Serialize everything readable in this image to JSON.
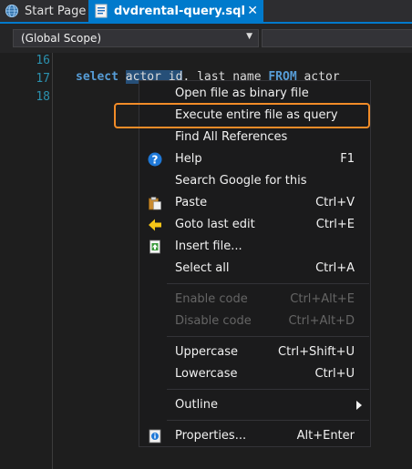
{
  "tabs": [
    {
      "label": "Start Page",
      "icon": "globe-icon"
    },
    {
      "label": "dvdrental-query.sql",
      "icon": "sql-file-icon",
      "close": "✕"
    }
  ],
  "scope": {
    "value": "(Global Scope)"
  },
  "editor": {
    "line_numbers": [
      "16",
      "17",
      "18"
    ],
    "code": {
      "kw1": "select",
      "sel": "actor_id",
      "rest1": ", last_name ",
      "kw2": "FROM",
      "rest2": " actor"
    }
  },
  "menu": {
    "items": [
      {
        "label": "Open file as binary file",
        "shortcut": ""
      },
      {
        "label": "Execute entire file as query",
        "shortcut": ""
      },
      {
        "label": "Find All References",
        "shortcut": ""
      },
      {
        "label": "Help",
        "shortcut": "F1",
        "icon": "help-icon"
      },
      {
        "label": "Search Google for this",
        "shortcut": ""
      },
      {
        "label": "Paste",
        "shortcut": "Ctrl+V",
        "icon": "paste-icon"
      },
      {
        "label": "Goto last edit",
        "shortcut": "Ctrl+E",
        "icon": "arrow-left-icon"
      },
      {
        "label": "Insert file...",
        "shortcut": "",
        "icon": "insert-file-icon"
      },
      {
        "label": "Select all",
        "shortcut": "Ctrl+A"
      },
      {
        "label": "Enable code",
        "shortcut": "Ctrl+Alt+E"
      },
      {
        "label": "Disable code",
        "shortcut": "Ctrl+Alt+D"
      },
      {
        "label": "Uppercase",
        "shortcut": "Ctrl+Shift+U"
      },
      {
        "label": "Lowercase",
        "shortcut": "Ctrl+U"
      },
      {
        "label": "Outline",
        "shortcut": ""
      },
      {
        "label": "Properties...",
        "shortcut": "Alt+Enter",
        "icon": "properties-icon"
      }
    ]
  },
  "colors": {
    "accent": "#007acc",
    "highlight_border": "#f28c28",
    "keyword": "#569cd6",
    "line_number": "#2b91af"
  }
}
